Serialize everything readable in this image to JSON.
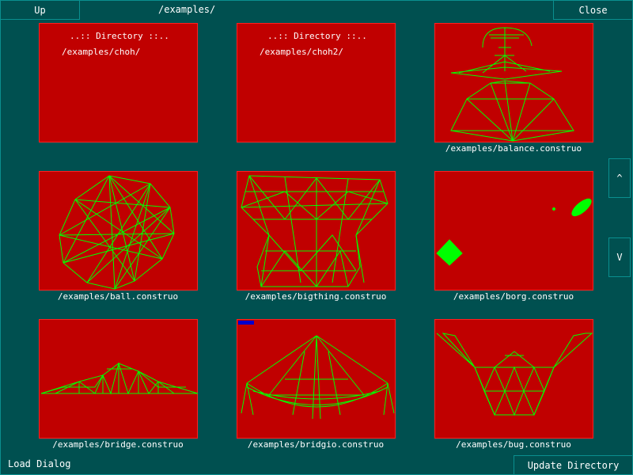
{
  "toolbar": {
    "up_label": "Up",
    "path": "/examples/",
    "close_label": "Close"
  },
  "grid": {
    "items": [
      {
        "kind": "directory",
        "header": "..:: Directory ::..",
        "path": "/examples/choh/"
      },
      {
        "kind": "directory",
        "header": "..:: Directory ::..",
        "path": "/examples/choh2/"
      },
      {
        "kind": "file",
        "caption": "/examples/balance.construo",
        "preview": "balance"
      },
      {
        "kind": "file",
        "caption": "/examples/ball.construo",
        "preview": "ball"
      },
      {
        "kind": "file",
        "caption": "/examples/bigthing.construo",
        "preview": "bigthing"
      },
      {
        "kind": "file",
        "caption": "/examples/borg.construo",
        "preview": "borg"
      },
      {
        "kind": "file",
        "caption": "/examples/bridge.construo",
        "preview": "bridge"
      },
      {
        "kind": "file",
        "caption": "/examples/bridgio.construo",
        "preview": "bridgio"
      },
      {
        "kind": "file",
        "caption": "/examples/bug.construo",
        "preview": "bug"
      }
    ]
  },
  "scroll": {
    "up_label": "^",
    "down_label": "V"
  },
  "footer": {
    "dialog_title": "Load Dialog",
    "update_label": "Update Directory"
  },
  "colors": {
    "background": "#005050",
    "thumb_fill": "#c00000",
    "thumb_border": "#ff2020",
    "wire": "#00ff00",
    "marker": "#0000cc",
    "button_border": "#0a8f8f"
  }
}
